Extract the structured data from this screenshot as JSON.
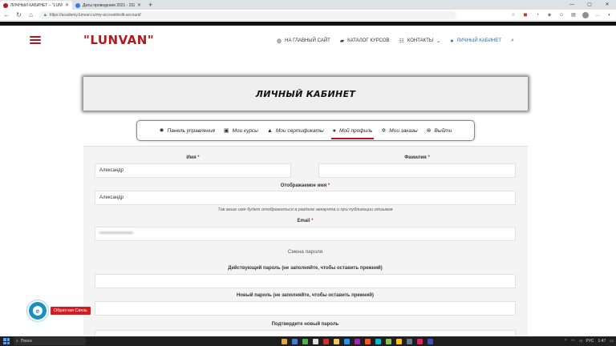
{
  "browser": {
    "tabs": [
      {
        "title": "ЛИЧНЫЙ КАБИНЕТ – \"LUNVAN\"",
        "active": true,
        "favicon_color": "#b3161b"
      },
      {
        "title": "Даты проведения 2021 - 2022",
        "active": false,
        "favicon_color": "#3b7dd8"
      }
    ],
    "new_tab": "+",
    "url": "https://academy.lunvan.ru/my-account/edit-account/",
    "window_controls": {
      "minimize": "—",
      "maximize": "▢",
      "close": "✕"
    }
  },
  "site": {
    "logo": "\"LUNVAN\"",
    "brand_color": "#b3161b",
    "nav": [
      {
        "label": "НА ГЛАВНЫЙ САЙТ",
        "icon": "globe-icon",
        "glyph": "◍"
      },
      {
        "label": "КАТАЛОГ КУРСОВ",
        "icon": "folder-icon",
        "glyph": "▰"
      },
      {
        "label": "КОНТАКТЫ",
        "icon": "list-icon",
        "glyph": "☷",
        "dropdown": "⌄"
      },
      {
        "label": "ЛИЧНЫЙ КАБИНЕТ",
        "icon": "user-icon",
        "glyph": "●"
      }
    ],
    "search_glyph": "⌕"
  },
  "banner": {
    "title": "ЛИЧНЫЙ КАБИНЕТ"
  },
  "account_nav": [
    {
      "label": "Панель управления",
      "icon": "gear-icon",
      "glyph": "✹"
    },
    {
      "label": "Мои курсы",
      "icon": "calendar-icon",
      "glyph": "▣"
    },
    {
      "label": "Мои сертификаты",
      "icon": "graduation-cap-icon",
      "glyph": "▲"
    },
    {
      "label": "Мой профиль",
      "icon": "user-icon",
      "glyph": "●",
      "active": true
    },
    {
      "label": "Мои заказы",
      "icon": "settings-cog-icon",
      "glyph": "✲"
    },
    {
      "label": "Выйти",
      "icon": "close-circle-icon",
      "glyph": "⊗"
    }
  ],
  "form": {
    "first_name": {
      "label": "Имя",
      "required": "*",
      "value": "Александр"
    },
    "last_name": {
      "label": "Фамилия",
      "required": "*",
      "value": ""
    },
    "display_name": {
      "label": "Отображаемое имя",
      "required": "*",
      "value": "Александр",
      "hint": "Так ваше имя будет отображаться в разделе аккаунта и при публикации отзывов"
    },
    "email": {
      "label": "Email",
      "required": "*",
      "value": "••••••••••••••••••••"
    },
    "password_section": "Смена пароля",
    "current_password": {
      "label": "Действующий пароль (не заполняйте, чтобы оставить прежний)",
      "value": ""
    },
    "new_password": {
      "label": "Новый пароль (не заполняйте, чтобы оставить прежний)",
      "value": ""
    },
    "confirm_password": {
      "label": "Подтвердите новый пароль",
      "value": ""
    }
  },
  "callback": {
    "label": "Обратная Связь",
    "glyph": "e"
  },
  "taskbar": {
    "search_placeholder": "Поиск",
    "time": "1:47",
    "lang": "РУС",
    "app_colors": [
      "#e8a33b",
      "#3b7dd8",
      "#4caf50",
      "#e0e0e0",
      "#d32f2f",
      "#f2c94c",
      "#2196f3",
      "#9c27b0",
      "#ff5722",
      "#00bcd4",
      "#8bc34a",
      "#ffc107",
      "#607d8b",
      "#e91e63",
      "#3f51b5"
    ]
  }
}
